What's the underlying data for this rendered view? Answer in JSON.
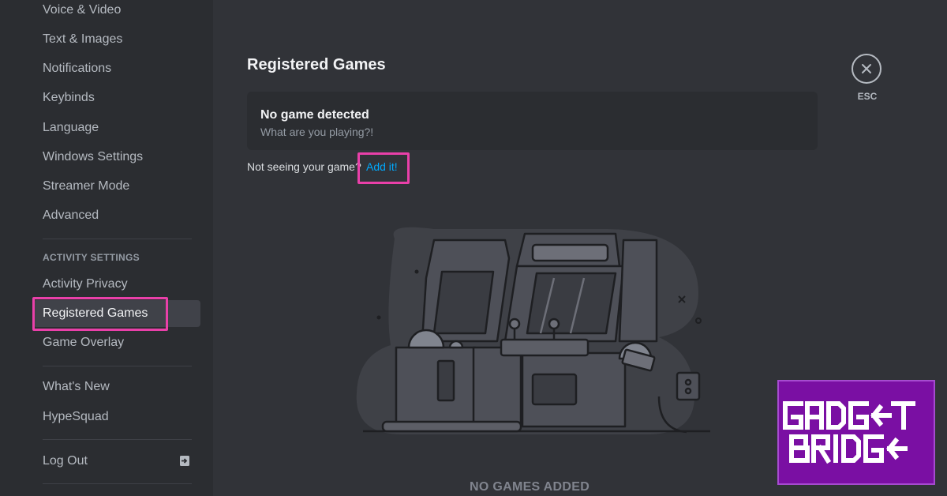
{
  "sidebar": {
    "items": [
      {
        "label": "Voice & Video"
      },
      {
        "label": "Text & Images"
      },
      {
        "label": "Notifications"
      },
      {
        "label": "Keybinds"
      },
      {
        "label": "Language"
      },
      {
        "label": "Windows Settings"
      },
      {
        "label": "Streamer Mode"
      },
      {
        "label": "Advanced"
      }
    ],
    "activity_header": "ACTIVITY SETTINGS",
    "activity_items": [
      {
        "label": "Activity Privacy"
      },
      {
        "label": "Registered Games"
      },
      {
        "label": "Game Overlay"
      }
    ],
    "selected": "Registered Games",
    "misc_items": [
      {
        "label": "What's New"
      },
      {
        "label": "HypeSquad"
      }
    ],
    "logout_label": "Log Out"
  },
  "main": {
    "title": "Registered Games",
    "game_box": {
      "title": "No game detected",
      "subtitle": "What are you playing?!"
    },
    "not_seeing_text": "Not seeing your game?",
    "add_link": "Add it!",
    "empty_state": "NO GAMES ADDED"
  },
  "close": {
    "label": "ESC",
    "icon": "close-icon"
  },
  "watermark": {
    "line1": "GADGET",
    "line2": "BRIDGE"
  },
  "colors": {
    "background": "#313338",
    "sidebar": "#2b2d31",
    "link": "#00a8fc",
    "highlight": "#e940a9",
    "logo_bg": "#7a0fa3"
  }
}
